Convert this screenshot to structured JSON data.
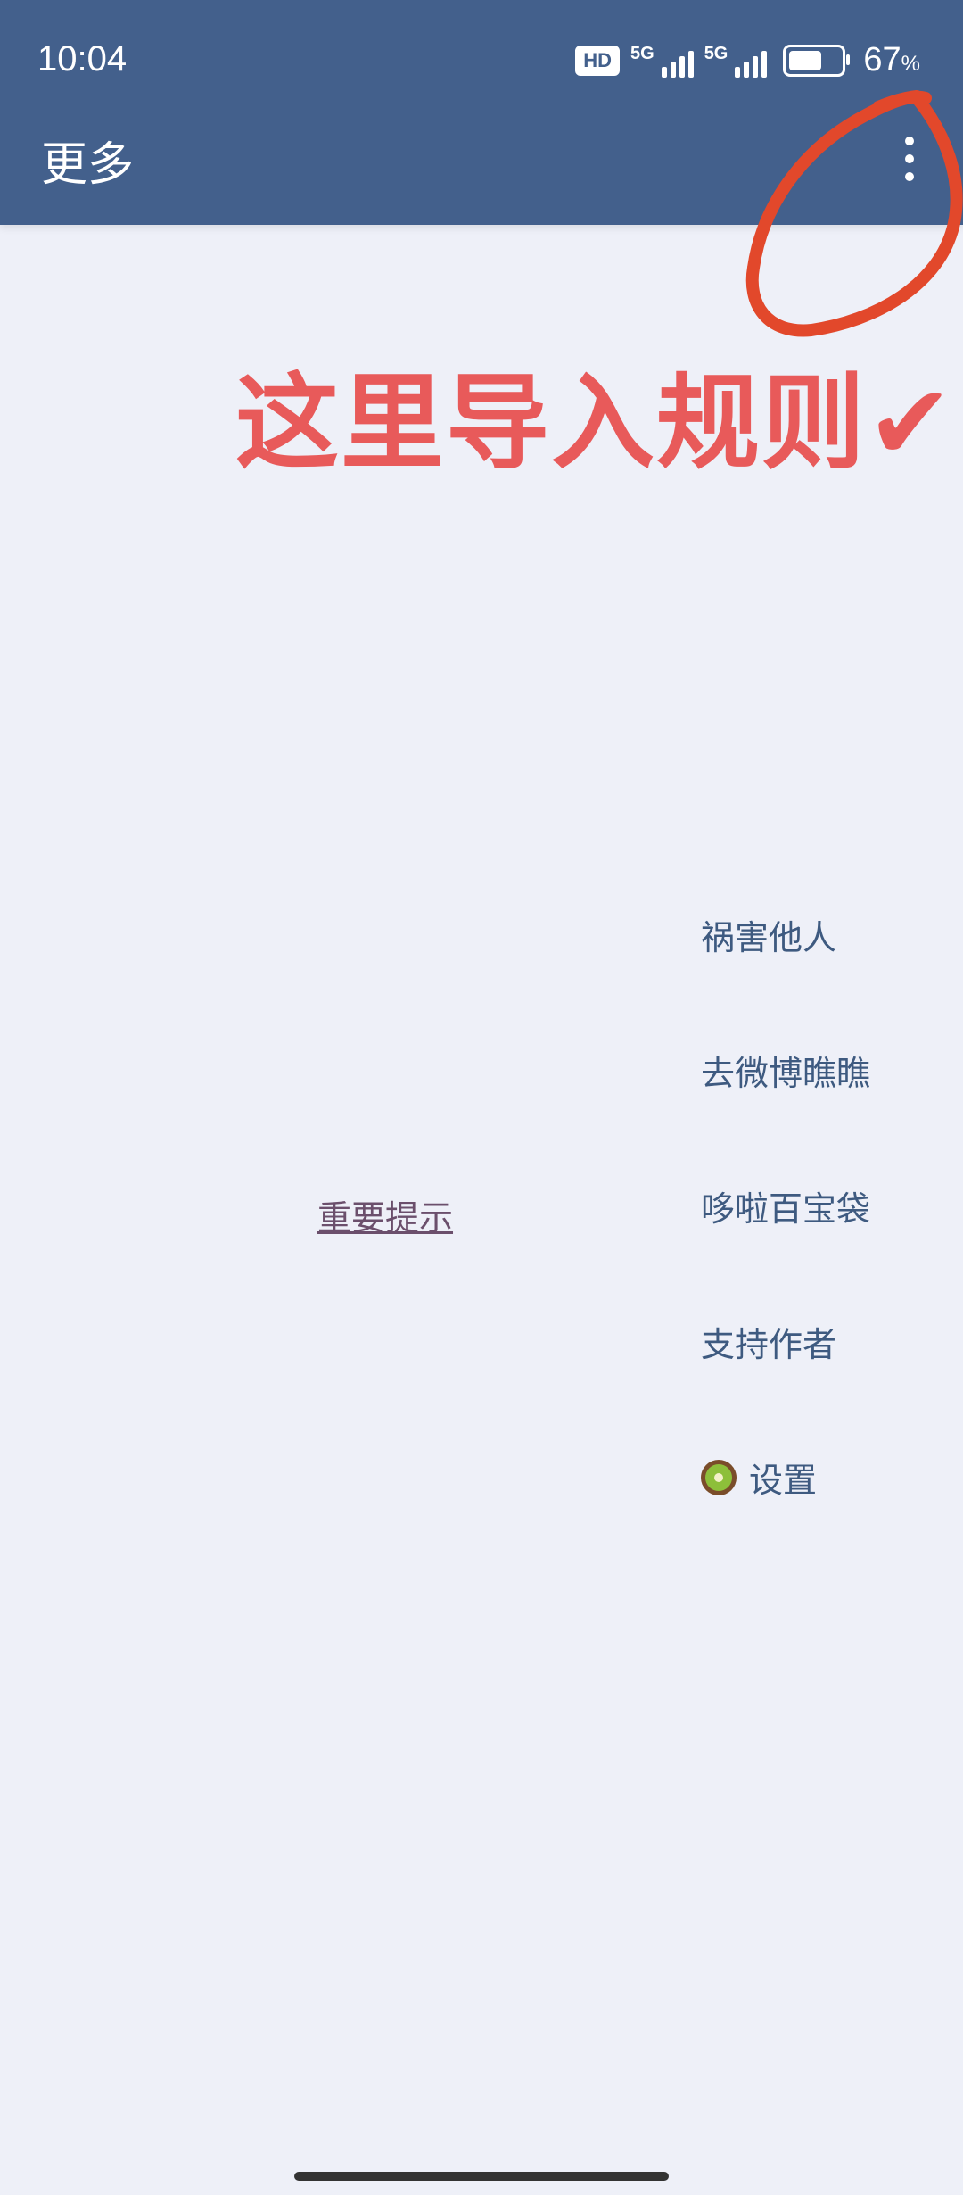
{
  "status_bar": {
    "time": "10:04",
    "hd_label": "HD",
    "network1": "5G",
    "network2": "5G",
    "battery_percent": "67",
    "percent_sign": "%",
    "battery_level": 0.67
  },
  "app_bar": {
    "title": "更多",
    "menu_icon": "more-vert-icon"
  },
  "annotation": {
    "text": "这里导入规则✔",
    "circle_color": "#e2482b"
  },
  "content": {
    "notice_link": "重要提示",
    "side_menu": [
      {
        "label": "祸害他人"
      },
      {
        "label": "去微博瞧瞧"
      },
      {
        "label": "哆啦百宝袋"
      },
      {
        "label": "支持作者"
      },
      {
        "label": "设置",
        "icon": "kiwi-icon"
      }
    ]
  },
  "colors": {
    "header_bg": "#43608c",
    "page_bg": "#eef0f8",
    "menu_text": "#3e5a80",
    "annotation_text": "#e85a5a"
  }
}
